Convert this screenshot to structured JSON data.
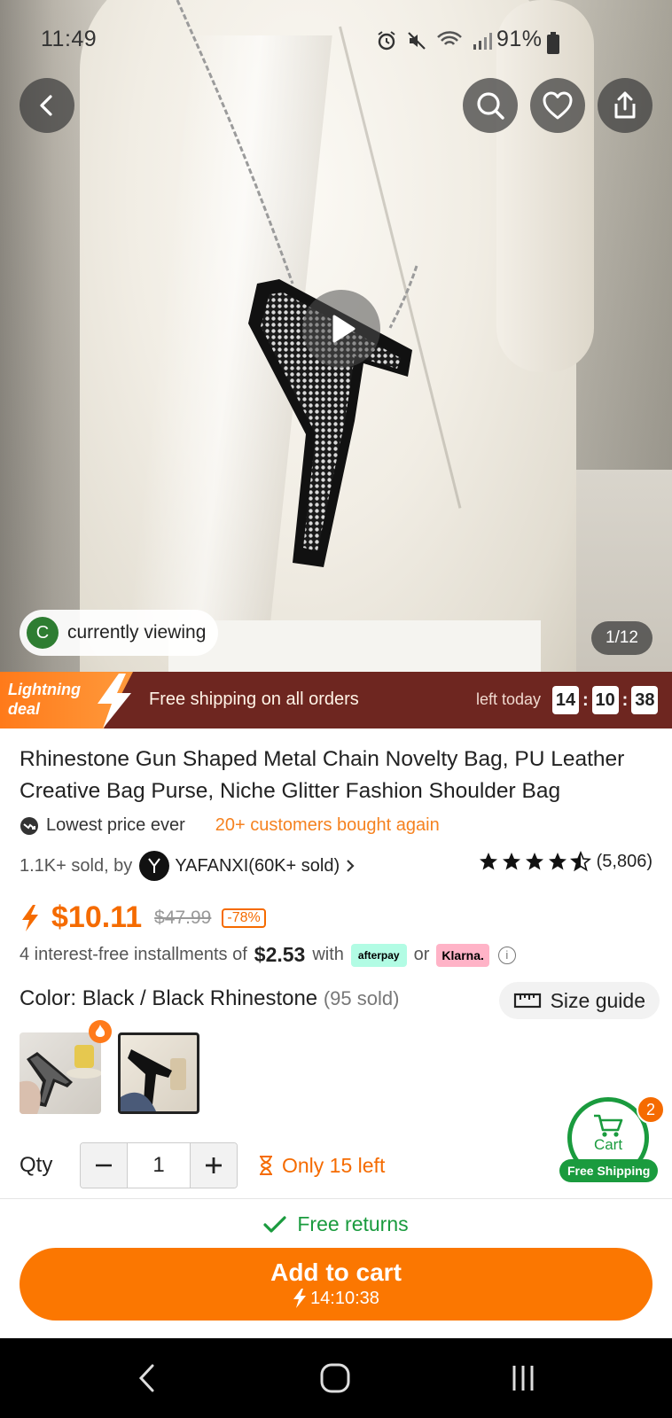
{
  "status_bar": {
    "time": "11:49",
    "battery": "91%"
  },
  "hero": {
    "viewing_avatar_letter": "C",
    "viewing_text": "currently viewing",
    "page_counter": "1/12"
  },
  "deal": {
    "badge_line1": "Lightning",
    "badge_line2": "deal",
    "free_shipping": "Free shipping on all orders",
    "left_today": "left today",
    "hours": "14",
    "minutes": "10",
    "seconds": "38"
  },
  "product": {
    "title": "Rhinestone Gun Shaped Metal Chain Novelty Bag, PU Leather Creative Bag Purse, Niche Glitter Fashion Shoulder Bag",
    "lowest_price": "Lowest price ever",
    "bought_again": "20+ customers bought again",
    "sold": "1.1K+ sold, by",
    "store_name": "YAFANXI(60K+ sold)",
    "rating": 4.5,
    "rating_count": "(5,806)",
    "price": "$10.11",
    "original_price": "$47.99",
    "discount": "-78%",
    "installments_prefix": "4 interest-free installments of",
    "installment_amount": "$2.53",
    "installments_with": "with",
    "afterpay": "afterpay",
    "or": "or",
    "klarna": "Klarna.",
    "color_label": "Color: Black / Black Rhinestone",
    "color_sold": "(95 sold)",
    "size_guide": "Size guide",
    "qty_label": "Qty",
    "qty_value": "1",
    "only_left": "Only 15 left"
  },
  "cart": {
    "count": "2",
    "label": "Cart",
    "free_shipping": "Free Shipping"
  },
  "footer": {
    "free_returns": "Free returns",
    "add_to_cart": "Add to cart",
    "timer": "14:10:38"
  },
  "colors": {
    "brand_orange": "#fb7701",
    "green": "#1a9b3e",
    "deal_bg": "#6e2620"
  }
}
